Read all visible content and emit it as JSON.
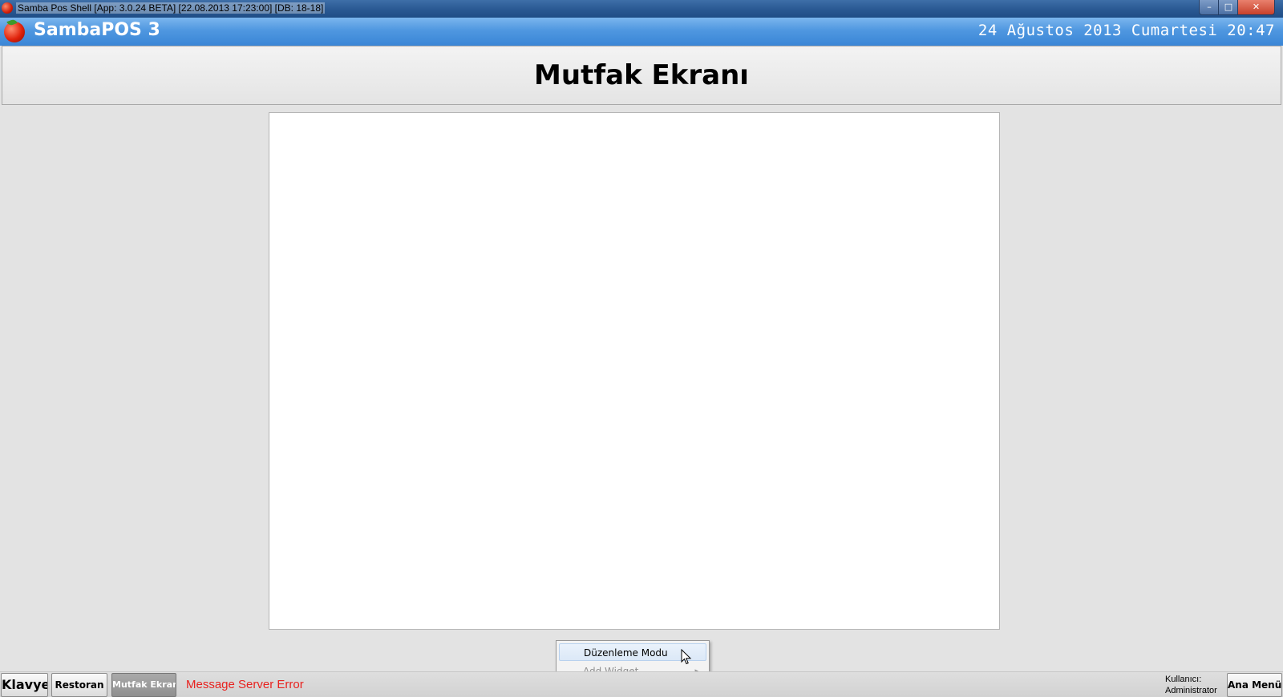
{
  "window": {
    "title": "Samba Pos Shell [App: 3.0.24 BETA] [22.08.2013 17:23:00] [DB: 18-18]",
    "minimize": "–",
    "maximize": "□",
    "close": "✕"
  },
  "header": {
    "app_name": "SambaPOS 3",
    "clock": "24 Ağustos 2013 Cumartesi 20:47"
  },
  "screen": {
    "title": "Mutfak Ekranı"
  },
  "context_menu": {
    "items": [
      {
        "label": "Düzenleme Modu",
        "enabled": true,
        "highlighted": true
      },
      {
        "label": "Add Widget",
        "enabled": false,
        "has_submenu": true,
        "submenu_arrow": "▸"
      }
    ]
  },
  "bottom_bar": {
    "keyboard_label": "Klavye",
    "buttons": [
      {
        "label": "Restoran",
        "active": false
      },
      {
        "label": "Mutfak Ekranı",
        "active": true
      }
    ],
    "message": "Message Server Error",
    "user_label": "Kullanıcı:",
    "user_name": "Administrator",
    "main_menu_label": "Ana Menü"
  },
  "colors": {
    "header_blue": "#4f97e0",
    "error_red": "#e8221f",
    "background": "#e3e3e3"
  }
}
